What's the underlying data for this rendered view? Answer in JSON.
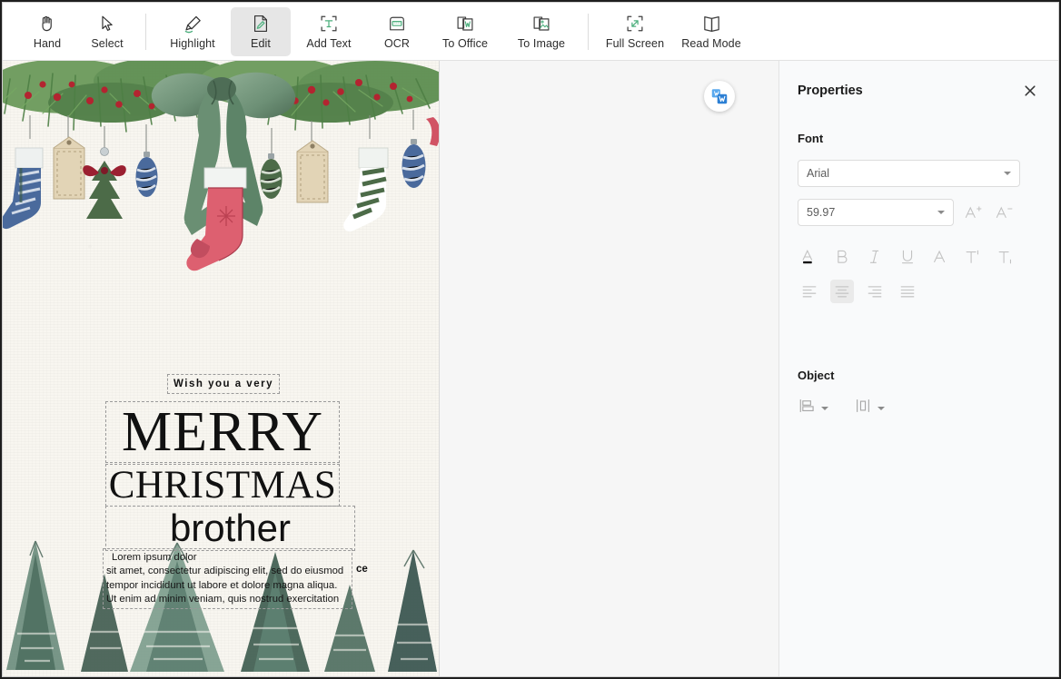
{
  "toolbar": {
    "groups": [
      {
        "items": [
          {
            "label": "Hand",
            "icon": "hand-icon",
            "active": false
          },
          {
            "label": "Select",
            "icon": "cursor-arrow-icon",
            "active": false
          }
        ]
      },
      {
        "items": [
          {
            "label": "Highlight",
            "icon": "highlighter-pen-icon",
            "active": false
          },
          {
            "label": "Edit",
            "icon": "edit-document-icon",
            "active": true
          },
          {
            "label": "Add Text",
            "icon": "add-text-icon",
            "active": false
          },
          {
            "label": "OCR",
            "icon": "ocr-icon",
            "active": false
          },
          {
            "label": "To Office",
            "icon": "to-word-icon",
            "active": false
          },
          {
            "label": "To Image",
            "icon": "to-image-icon",
            "active": false
          }
        ]
      },
      {
        "items": [
          {
            "label": "Full Screen",
            "icon": "full-screen-icon",
            "active": false
          },
          {
            "label": "Read Mode",
            "icon": "book-open-icon",
            "active": false
          }
        ]
      }
    ]
  },
  "workspace": {
    "convert_button_tooltip": "Convert to Word",
    "page": {
      "text_boxes": [
        {
          "name": "wish-textbox",
          "text": "Wish you a very"
        },
        {
          "name": "merry-textbox",
          "text": "MERRY"
        },
        {
          "name": "christmas-textbox",
          "text": "CHRISTMAS"
        },
        {
          "name": "brother-textbox",
          "text": "brother"
        }
      ],
      "body_lines": [
        "Lorem ipsum dolor",
        "sit amet, consectetur adipiscing elit, sed do eiusmod",
        "tempor incididunt ut labore et dolore magna aliqua.",
        "Ut enim ad minim veniam, quis nostrud exercitation"
      ],
      "stray_fragment": "ce"
    }
  },
  "properties": {
    "title": "Properties",
    "close_label": "✕",
    "font": {
      "section_title": "Font",
      "family_value": "Arial",
      "family_placeholder": "Arial",
      "size_value": "59.97",
      "size_placeholder": "59.97",
      "increase_label": "A+",
      "decrease_label": "A-",
      "format_buttons": [
        {
          "name": "font-color-button",
          "label": "A",
          "active": true
        },
        {
          "name": "bold-button",
          "label": "B",
          "active": false
        },
        {
          "name": "italic-button",
          "label": "I",
          "active": false
        },
        {
          "name": "underline-button",
          "label": "U",
          "active": false
        },
        {
          "name": "strikethrough-button",
          "label": "A",
          "active": false
        },
        {
          "name": "superscript-button",
          "label": "T",
          "active": false
        },
        {
          "name": "subscript-button",
          "label": "T",
          "active": false
        }
      ],
      "align_buttons": [
        {
          "name": "align-left-button",
          "active": false
        },
        {
          "name": "align-center-button",
          "active": true
        },
        {
          "name": "align-right-button",
          "active": false
        },
        {
          "name": "align-justify-button",
          "active": false
        }
      ]
    },
    "object": {
      "section_title": "Object",
      "align_objects_label": "Align",
      "distribute_objects_label": "Distribute"
    }
  },
  "colors": {
    "accent_green": "#4caf7d",
    "toolbar_text": "#2c2c2c",
    "panel_bg": "#f9fafb",
    "workspace_bg": "#f6f6f6",
    "active_tool_bg": "#e6e6e6",
    "convert_blue": "#2b8ce5"
  }
}
